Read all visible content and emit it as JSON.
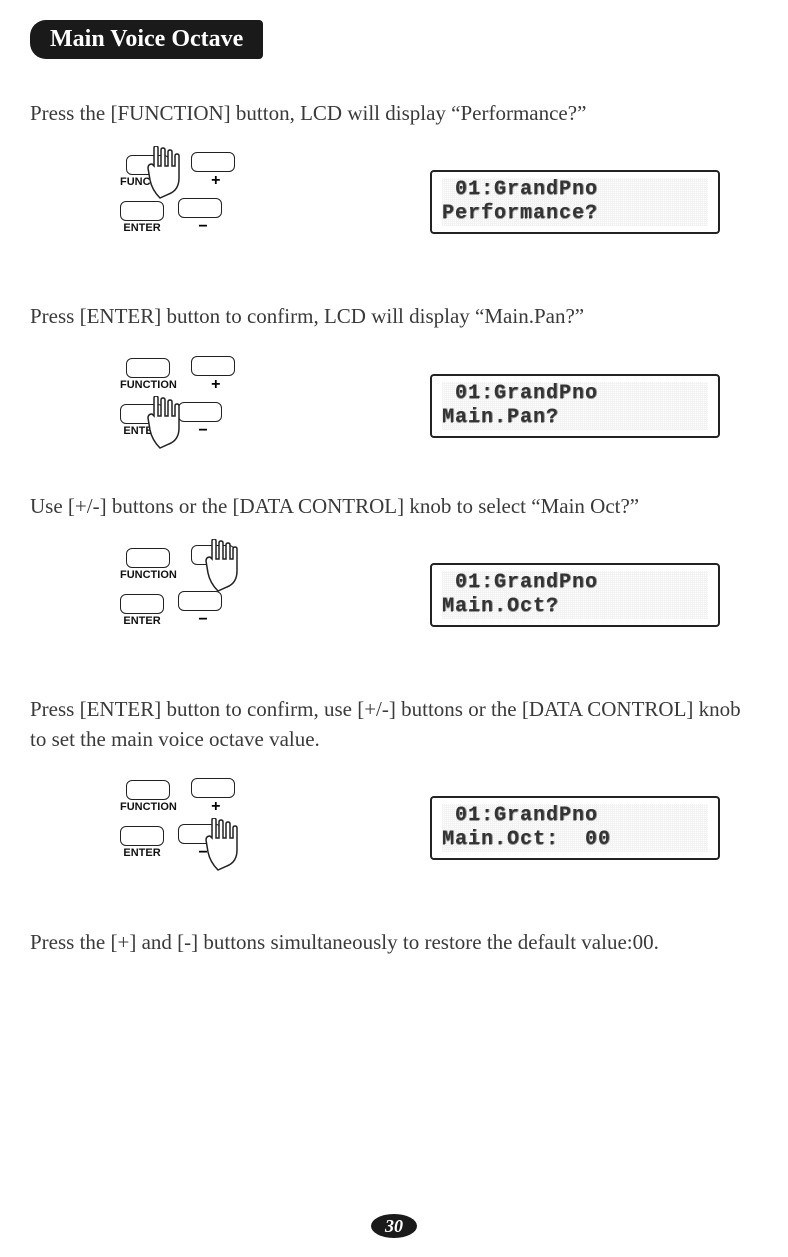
{
  "title": "Main Voice Octave",
  "steps": {
    "s1": {
      "text": "Press the [FUNCTION] button, LCD will display “Performance?”",
      "lcd_line1": " 01:GrandPno",
      "lcd_line2": "Performance?"
    },
    "s2": {
      "text": "Press [ENTER] button to confirm, LCD will display “Main.Pan?”",
      "lcd_line1": " 01:GrandPno",
      "lcd_line2": "Main.Pan?"
    },
    "s3": {
      "text": "Use [+/-] buttons or the [DATA CONTROL] knob to select “Main Oct?”",
      "lcd_line1": " 01:GrandPno",
      "lcd_line2": "Main.Oct?"
    },
    "s4": {
      "text": "Press [ENTER] button to confirm, use [+/-] buttons or the [DATA CONTROL] knob to set the main voice octave value.",
      "lcd_line1": " 01:GrandPno",
      "lcd_line2": "Main.Oct:  00"
    },
    "s5": {
      "text": "Press the [+] and [-] buttons simultaneously to restore the default value:00."
    }
  },
  "labels": {
    "function": "FUNCTION",
    "enter": "ENTER",
    "plus": "+",
    "minus": "−"
  },
  "page_number": "30"
}
